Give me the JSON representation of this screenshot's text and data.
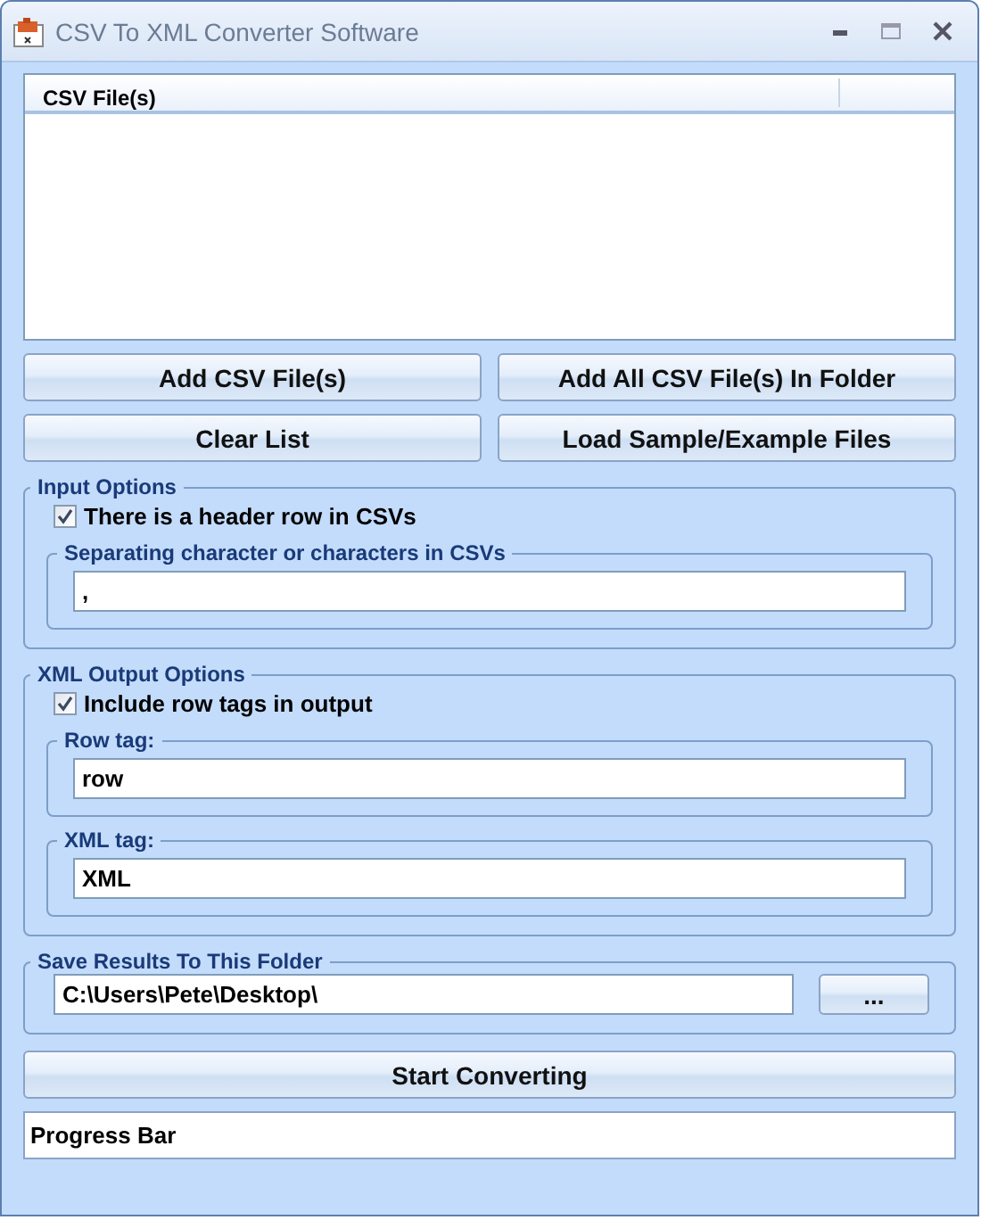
{
  "window": {
    "title": "CSV To XML Converter Software"
  },
  "file_list": {
    "columns": [
      "CSV File(s)"
    ]
  },
  "buttons": [
    {
      "label": "Add CSV File(s)"
    },
    {
      "label": "Add All CSV File(s) In Folder"
    },
    {
      "label": "Clear List"
    },
    {
      "label": "Load Sample/Example Files"
    }
  ],
  "option_groups": [
    {
      "title": "Input Options",
      "checkbox": {
        "label": "There is a header row in CSVs",
        "checked": true
      },
      "fields": [
        {
          "label": "Separating character or characters in CSVs",
          "value": ","
        }
      ]
    },
    {
      "title": "XML Output Options",
      "checkbox": {
        "label": "Include row tags in output",
        "checked": true
      },
      "fields": [
        {
          "label": "Row tag:",
          "value": "row"
        },
        {
          "label": "XML tag:",
          "value": "XML"
        }
      ]
    }
  ],
  "save_folder": {
    "title": "Save Results To This Folder",
    "value": "C:\\Users\\Pete\\Desktop\\",
    "browse_button": "..."
  },
  "start_button": {
    "label": "Start Converting"
  },
  "progress_bar": {
    "label": "Progress Bar"
  }
}
